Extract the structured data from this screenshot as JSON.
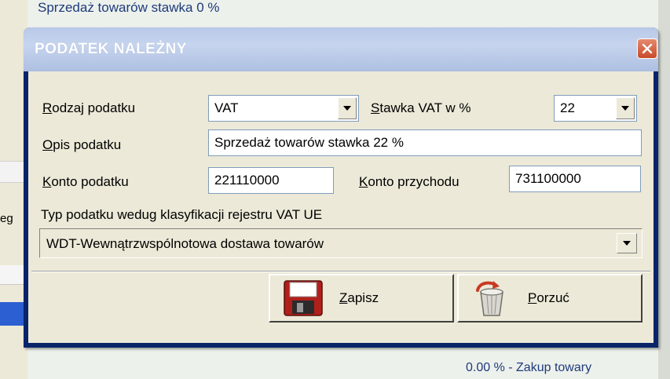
{
  "background": {
    "top_text": "Sprzedaż towarów stawka 0 %",
    "left_text": "eg",
    "bottom_text": "0.00 %  -  Zakup towary"
  },
  "dialog": {
    "title": "PODATEK NALEŻNY",
    "rodzaj": {
      "label_u": "R",
      "label_rest": "odzaj podatku",
      "value": "VAT"
    },
    "stawka": {
      "label_u": "S",
      "label_rest": "tawka VAT w  %",
      "value": "22"
    },
    "opis": {
      "label_u": "O",
      "label_rest": "pis podatku",
      "value": "Sprzedaż towarów stawka 22 %"
    },
    "konto_podatku": {
      "label_u": "K",
      "label_rest": "onto podatku",
      "value": "221110000"
    },
    "konto_przychodu": {
      "label_u": "K",
      "label_rest": "onto przychodu",
      "value": "731100000"
    },
    "typ": {
      "label": "Typ podatku wedug klasyfikacji rejestru VAT UE",
      "value": "WDT-Wewnątrzwspólnotowa dostawa towarów"
    },
    "buttons": {
      "save": {
        "label_u": "Z",
        "label_rest": "apisz",
        "icon": "floppy-disk-icon"
      },
      "cancel": {
        "label_u": "P",
        "label_rest": "orzuć",
        "icon": "trash-bin-icon"
      }
    },
    "colors": {
      "title_gradient": "#b8c9e8",
      "close": "#d35a3a",
      "dialog_bg": "#ece9d8"
    }
  }
}
